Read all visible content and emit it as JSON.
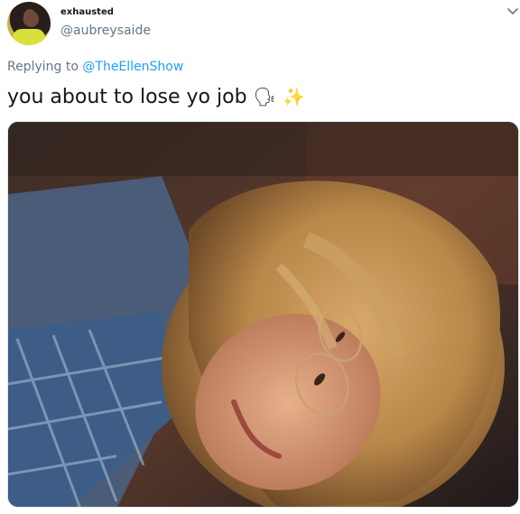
{
  "tweet": {
    "display_name": "exhausted",
    "handle": "@aubreysaide",
    "replying_prefix": "Replying to",
    "replying_to": "@TheEllenShow",
    "text": "you about to lose yo job",
    "emojis": [
      "🗣",
      "✨"
    ]
  },
  "icons": {
    "caret": "chevron-down-icon",
    "avatar": "avatar-photo"
  },
  "colors": {
    "link": "#1da1f2",
    "muted": "#657786",
    "text": "#14171a"
  }
}
